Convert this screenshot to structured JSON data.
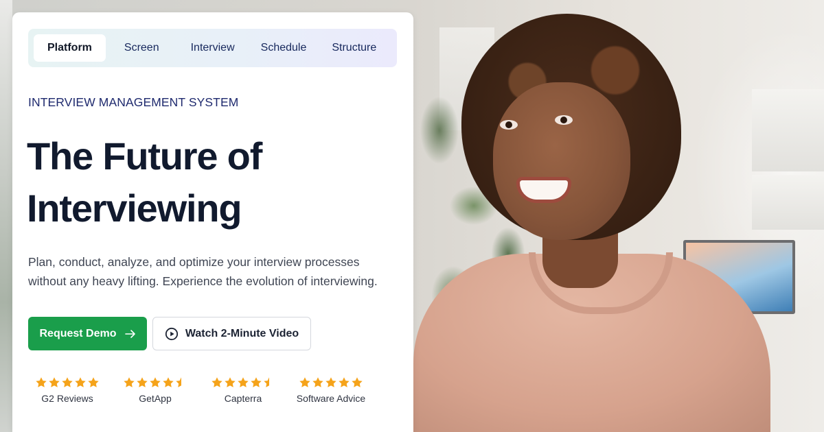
{
  "nav": {
    "tabs": [
      {
        "label": "Platform",
        "active": true
      },
      {
        "label": "Screen",
        "active": false
      },
      {
        "label": "Interview",
        "active": false
      },
      {
        "label": "Schedule",
        "active": false
      },
      {
        "label": "Structure",
        "active": false
      }
    ]
  },
  "hero": {
    "eyebrow": "INTERVIEW MANAGEMENT SYSTEM",
    "headline_line1": "The Future of",
    "headline_line2": "Interviewing",
    "subtext_line1": "Plan, conduct, analyze, and optimize your interview processes",
    "subtext_line2": "without any heavy lifting. Experience the evolution of interviewing.",
    "primary_cta": "Request Demo",
    "secondary_cta": "Watch 2-Minute Video"
  },
  "ratings": [
    {
      "label": "G2 Reviews",
      "stars": 5
    },
    {
      "label": "GetApp",
      "stars": 4.5
    },
    {
      "label": "Capterra",
      "stars": 4.5
    },
    {
      "label": "Software Advice",
      "stars": 5
    }
  ],
  "colors": {
    "accent_green": "#1a9e4b",
    "star_orange": "#f5a31a",
    "nav_text": "#16275c",
    "heading": "#111a2e"
  },
  "icons": {
    "primary_cta_icon": "arrow-right-icon",
    "secondary_cta_icon": "play-circle-icon",
    "rating_icon": "star-icon"
  }
}
